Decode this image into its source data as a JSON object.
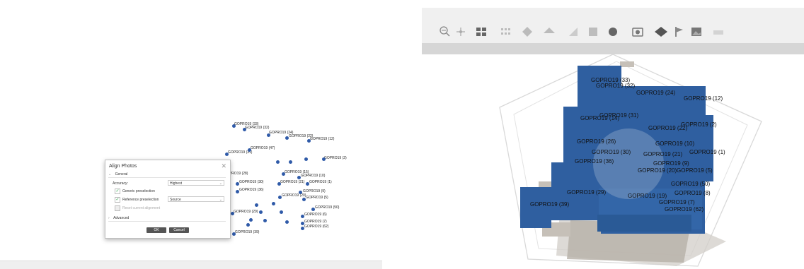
{
  "left_panel": {
    "photo_labels": [
      {
        "text": "GOPRO19 (33)"
      },
      {
        "text": "GOPRO19 (32)"
      },
      {
        "text": "GOPRO19 (24)"
      },
      {
        "text": "GOPRO19 (22)"
      },
      {
        "text": "GOPRO19 (12)"
      },
      {
        "text": "GOPRO19 (47)"
      },
      {
        "text": "GOPRO19 (31)"
      },
      {
        "text": "GOPRO19 (28)"
      },
      {
        "text": "GOPRO19 (2)"
      },
      {
        "text": "GOPRO19 (15)"
      },
      {
        "text": "GOPRO19 (10)"
      },
      {
        "text": "GOPRO19 (30)"
      },
      {
        "text": "GOPRO19 (21)"
      },
      {
        "text": "GOPRO19 (1)"
      },
      {
        "text": "GOPRO19 (36)"
      },
      {
        "text": "GOPRO19 (20)"
      },
      {
        "text": "GOPRO19 (9)"
      },
      {
        "text": "GOPRO19 (5)"
      },
      {
        "text": "GOPRO19 (29)"
      },
      {
        "text": "GOPRO19 (50)"
      },
      {
        "text": "GOPRO19 (6)"
      },
      {
        "text": "GOPRO19 (7)"
      },
      {
        "text": "GOPRO19 (62)"
      },
      {
        "text": "GOPRO19 (39)"
      }
    ],
    "dialog": {
      "title": "Align Photos",
      "close": "✕",
      "general": "General",
      "accuracy_label": "Accuracy:",
      "accuracy_value": "Highest",
      "generic_preselection": "Generic preselection",
      "reference_preselection": "Reference preselection",
      "reference_value": "Source",
      "reset_alignment": "Reset current alignment",
      "advanced": "Advanced",
      "ok": "OK",
      "cancel": "Cancel"
    }
  },
  "right_panel": {
    "camera_labels": [
      {
        "text": "GOPRO19 (33)"
      },
      {
        "text": "GOPRO19 (32)"
      },
      {
        "text": "GOPRO19 (24)"
      },
      {
        "text": "GOPRO19 (12)"
      },
      {
        "text": "GOPRO19 (31)"
      },
      {
        "text": "GOPRO19 (14)"
      },
      {
        "text": "GOPRO19 (2)"
      },
      {
        "text": "GOPRO19 (22)"
      },
      {
        "text": "GOPRO19 (26)"
      },
      {
        "text": "GOPRO19 (10)"
      },
      {
        "text": "GOPRO19 (30)"
      },
      {
        "text": "GOPRO19 (21)"
      },
      {
        "text": "GOPRO19 (1)"
      },
      {
        "text": "GOPRO19 (36)"
      },
      {
        "text": "GOPRO19 (9)"
      },
      {
        "text": "GOPRO19 (20)"
      },
      {
        "text": "GOPRO19 (5)"
      },
      {
        "text": "GOPRO19 (50)"
      },
      {
        "text": "GOPRO19 (29)"
      },
      {
        "text": "GOPRO19 (8)"
      },
      {
        "text": "GOPRO19 (19)"
      },
      {
        "text": "GOPRO19 (7)"
      },
      {
        "text": "GOPRO19 (39)"
      },
      {
        "text": "GOPRO19 (62)"
      }
    ]
  },
  "colors": {
    "camera_blue": "#2f5fa0",
    "point_dot": "#2f5aa8"
  }
}
